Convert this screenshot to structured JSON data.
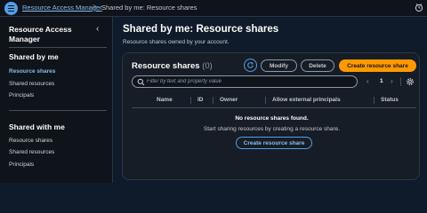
{
  "topbar": {
    "menu_icon": "hamburger-icon",
    "breadcrumb_root": "Resource Access Manager",
    "breadcrumb_separator": ">",
    "breadcrumb_current": "Shared by me: Resource shares",
    "notification_icon": "alarm-icon"
  },
  "sidebar": {
    "title": "Resource Access Manager",
    "close_glyph": "‹",
    "sections": [
      {
        "heading": "Shared by me",
        "items": [
          {
            "label": "Resource shares",
            "active": true
          },
          {
            "label": "Shared resources",
            "active": false
          },
          {
            "label": "Principals",
            "active": false
          }
        ]
      },
      {
        "heading": "Shared with me",
        "items": [
          {
            "label": "Resource shares",
            "active": false
          },
          {
            "label": "Shared resources",
            "active": false
          },
          {
            "label": "Principals",
            "active": false
          }
        ]
      }
    ]
  },
  "main": {
    "title": "Shared by me: Resource shares",
    "description": "Resource shares owned by your account."
  },
  "panel": {
    "title": "Resource shares",
    "count": "(0)",
    "refresh_icon": "refresh-icon",
    "modify_label": "Modify",
    "delete_label": "Delete",
    "create_label": "Create resource share",
    "filter_placeholder": "Filter by text and property value",
    "pager_prev": "‹",
    "page_number": "1",
    "pager_next": "›",
    "settings_icon": "gear-icon",
    "columns": [
      "Name",
      "ID",
      "Owner",
      "Allow external principals",
      "Status"
    ],
    "empty_title": "No resource shares found.",
    "empty_description": "Start sharing resources by creating a resource share.",
    "empty_button": "Create resource share"
  },
  "colors": {
    "accent": "#539fe5",
    "primary_button": "#ff9900",
    "background": "#0f1b2a",
    "panel": "#161d26"
  }
}
